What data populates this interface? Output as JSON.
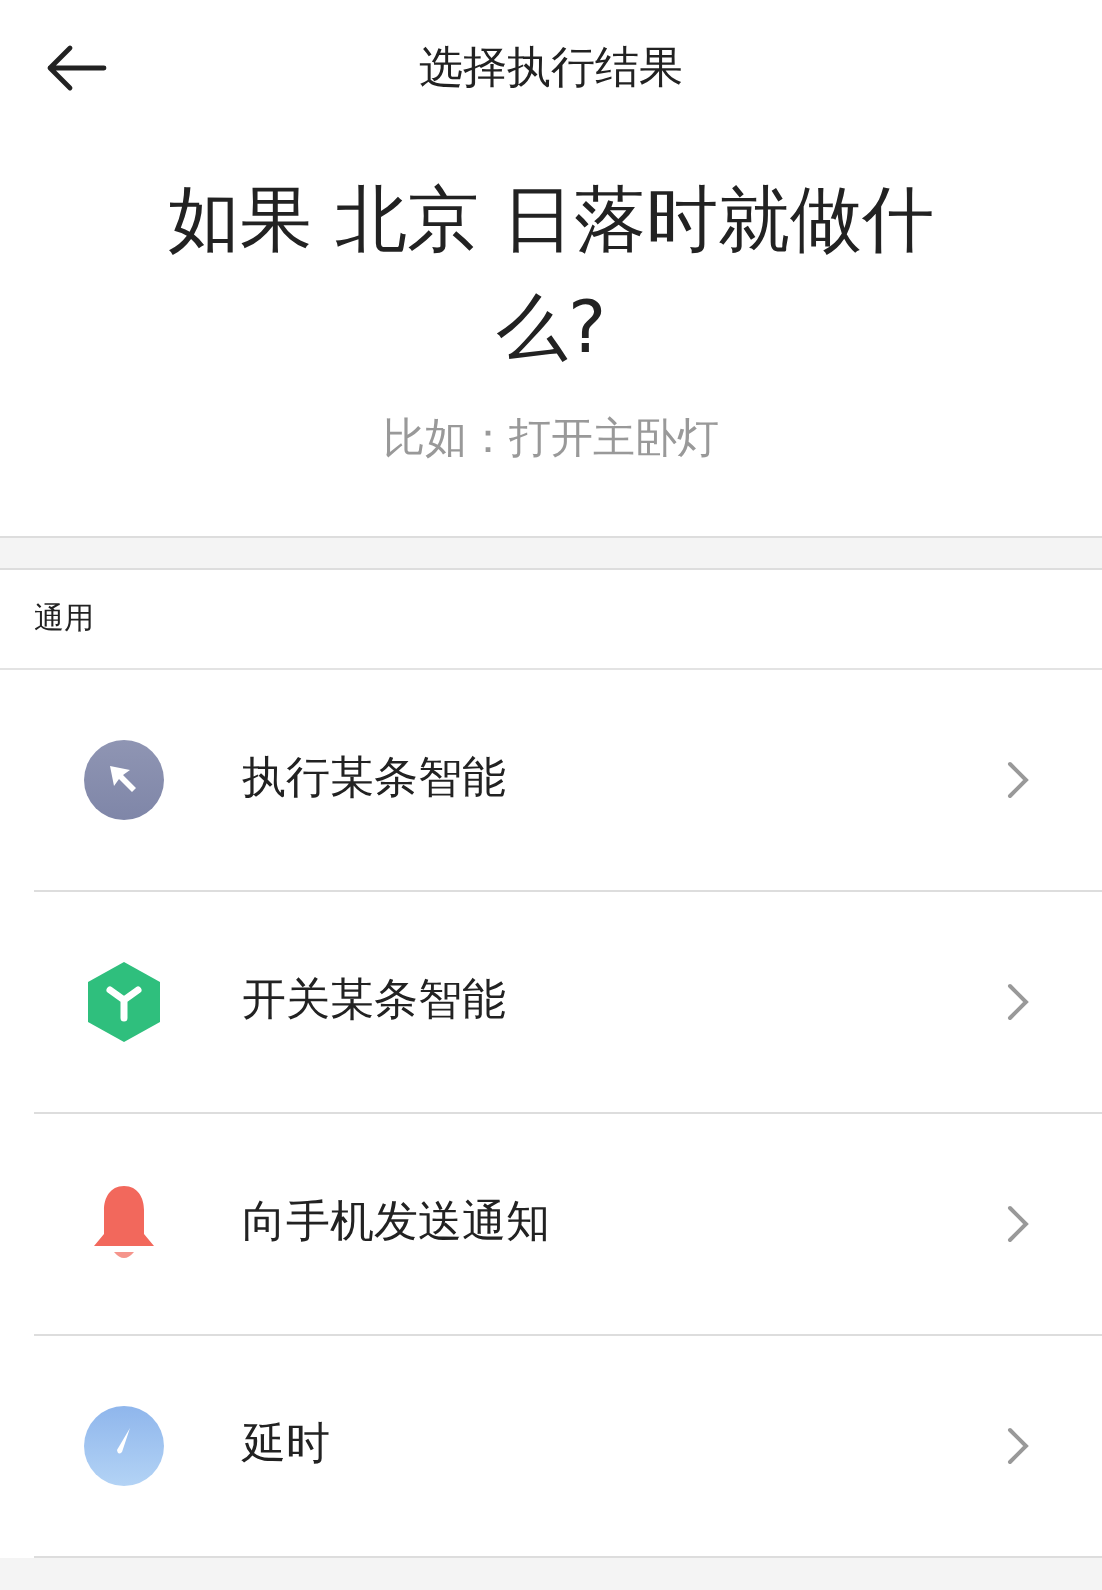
{
  "header": {
    "title": "选择执行结果"
  },
  "question": {
    "title": "如果 北京 日落时就做什么?",
    "hint": "比如：打开主卧灯"
  },
  "section": {
    "label": "通用"
  },
  "actions": [
    {
      "kind": "run",
      "label": "执行某条智能"
    },
    {
      "kind": "toggle",
      "label": "开关某条智能"
    },
    {
      "kind": "notify",
      "label": "向手机发送通知"
    },
    {
      "kind": "delay",
      "label": "延时"
    }
  ]
}
